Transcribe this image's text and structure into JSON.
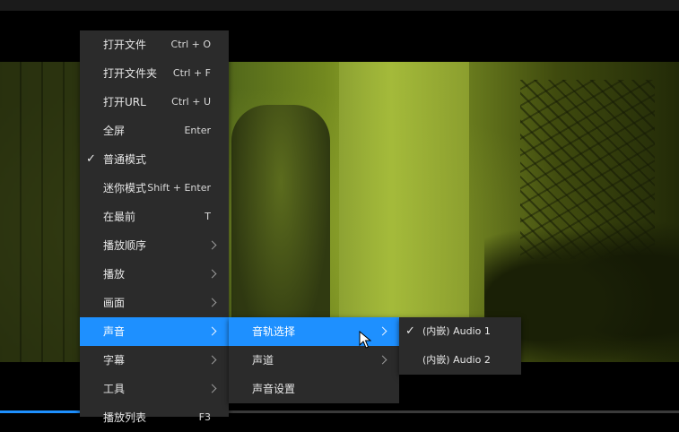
{
  "main_menu": {
    "items": [
      {
        "label": "打开文件",
        "shortcut": "Ctrl + O"
      },
      {
        "label": "打开文件夹",
        "shortcut": "Ctrl + F"
      },
      {
        "label": "打开URL",
        "shortcut": "Ctrl + U"
      },
      {
        "label": "全屏",
        "shortcut": "Enter"
      },
      {
        "label": "普通模式",
        "checked": true
      },
      {
        "label": "迷你模式",
        "shortcut": "Shift + Enter"
      },
      {
        "label": "在最前",
        "shortcut": "T"
      },
      {
        "label": "播放顺序",
        "submenu": true
      },
      {
        "label": "播放",
        "submenu": true
      },
      {
        "label": "画面",
        "submenu": true
      },
      {
        "label": "声音",
        "submenu": true,
        "highlighted": true
      },
      {
        "label": "字幕",
        "submenu": true
      },
      {
        "label": "工具",
        "submenu": true
      },
      {
        "label": "播放列表",
        "shortcut": "F3"
      }
    ]
  },
  "sound_menu": {
    "items": [
      {
        "label": "音轨选择",
        "submenu": true,
        "highlighted": true
      },
      {
        "label": "声道",
        "submenu": true
      },
      {
        "label": "声音设置"
      }
    ]
  },
  "track_menu": {
    "items": [
      {
        "label": "(内嵌) Audio 1",
        "checked": true
      },
      {
        "label": "(内嵌) Audio 2"
      }
    ]
  },
  "check_glyph": "✓",
  "colors": {
    "highlight": "#1e90ff",
    "menu_bg": "#2b2b2b"
  },
  "playback": {
    "progress": 0.12
  }
}
